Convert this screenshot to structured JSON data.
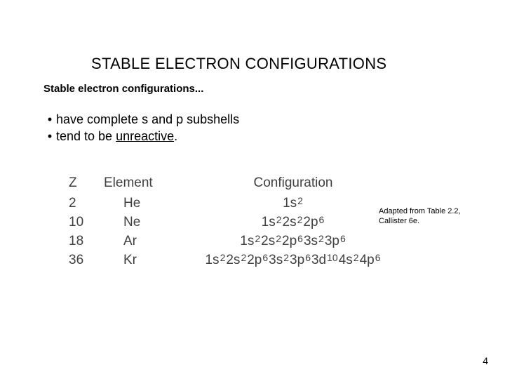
{
  "title": "STABLE ELECTRON CONFIGURATIONS",
  "subtitle": "Stable electron configurations...",
  "bullets": [
    {
      "lead": "have complete s and p subshells"
    },
    {
      "lead": "tend to be ",
      "underlined": "unreactive",
      "trail": "."
    }
  ],
  "table": {
    "headers": {
      "z": "Z",
      "element": "Element",
      "config": "Configuration"
    },
    "rows": [
      {
        "z": "2",
        "el": "He",
        "shells": [
          "1s2"
        ]
      },
      {
        "z": "10",
        "el": "Ne",
        "shells": [
          "1s2",
          "2s2",
          "2p6"
        ]
      },
      {
        "z": "18",
        "el": "Ar",
        "shells": [
          "1s2",
          "2s2",
          "2p6",
          "3s2",
          "3p6"
        ]
      },
      {
        "z": "36",
        "el": "Kr",
        "shells": [
          "1s2",
          "2s2",
          "2p6",
          "3s2",
          "3p6",
          "3d10",
          "4s2",
          "4p6"
        ]
      }
    ]
  },
  "citation": {
    "line1": "Adapted from Table 2.2,",
    "line2": "Callister 6e."
  },
  "page_number": "4"
}
